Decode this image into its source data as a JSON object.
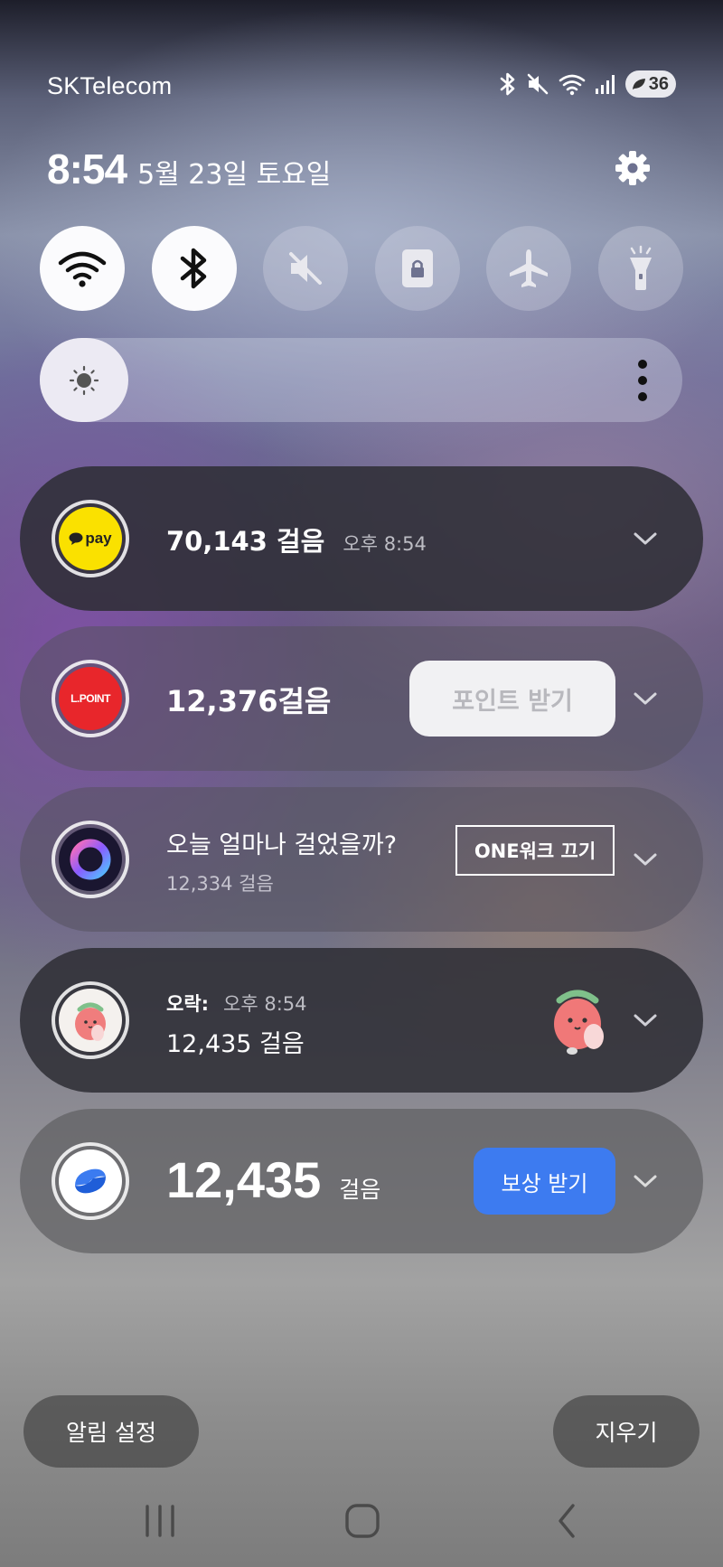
{
  "status_bar": {
    "carrier": "SKTelecom",
    "battery": "36",
    "icons": [
      "bluetooth-icon",
      "mute-icon",
      "wifi-icon",
      "signal-icon",
      "battery-icon"
    ]
  },
  "panel": {
    "time": "8:54",
    "date": "5월 23일 토요일"
  },
  "quick_toggles": [
    {
      "name": "wifi-icon",
      "state": "on"
    },
    {
      "name": "bluetooth-icon",
      "state": "on"
    },
    {
      "name": "mute-icon",
      "state": "off"
    },
    {
      "name": "screen-lock-icon",
      "state": "off"
    },
    {
      "name": "airplane-icon",
      "state": "off"
    },
    {
      "name": "flashlight-icon",
      "state": "off"
    }
  ],
  "brightness": {
    "level": 0.05
  },
  "notifications": [
    {
      "app_icon_text": "pay",
      "title": "70,143 걸음",
      "time": "오후 8:54"
    },
    {
      "app_icon_text": "L.POINT",
      "title": "12,376걸음",
      "button": "포인트 받기"
    },
    {
      "title": "오늘 얼마나 걸었을까?",
      "subtitle": "12,334 걸음",
      "button": "ONE워크 끄기"
    },
    {
      "sender": "오락:",
      "time": "오후 8:54",
      "title": "12,435 걸음"
    },
    {
      "value": "12,435",
      "unit": "걸음",
      "button": "보상 받기"
    }
  ],
  "bottom": {
    "settings_label": "알림 설정",
    "clear_label": "지우기"
  },
  "colors": {
    "kakao_yellow": "#fae100",
    "lpoint_red": "#e8262b",
    "reward_blue": "#3d7bf0"
  }
}
